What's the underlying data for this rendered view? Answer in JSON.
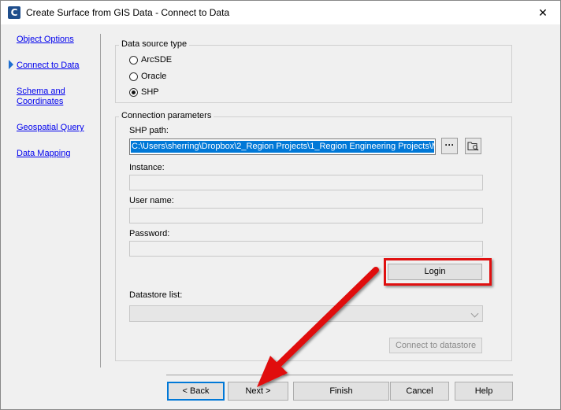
{
  "window": {
    "title": "Create Surface from GIS Data - Connect to Data",
    "close_glyph": "✕",
    "app_icon_letter": "C"
  },
  "nav": {
    "items": [
      {
        "label": "Object Options"
      },
      {
        "label": "Connect to Data"
      },
      {
        "label": "Schema and\nCoordinates"
      },
      {
        "label": "Geospatial Query"
      },
      {
        "label": "Data Mapping"
      }
    ],
    "active_index": 1
  },
  "data_source": {
    "title": "Data source type",
    "options": [
      {
        "label": "ArcSDE",
        "checked": false
      },
      {
        "label": "Oracle",
        "checked": false
      },
      {
        "label": "SHP",
        "checked": true
      }
    ]
  },
  "connection": {
    "title": "Connection parameters",
    "shp_path_label": "SHP path:",
    "shp_path_value": "C:\\Users\\sherring\\Dropbox\\2_Region Projects\\1_Region Engineering Projects\\M",
    "browse_glyph": "···",
    "instance_label": "Instance:",
    "username_label": "User name:",
    "password_label": "Password:",
    "login_label": "Login",
    "datastore_label": "Datastore list:",
    "connect_label": "Connect to datastore"
  },
  "footer": {
    "back_label": "< Back",
    "next_label": "Next >",
    "finish_label": "Finish",
    "cancel_label": "Cancel",
    "help_label": "Help"
  },
  "colors": {
    "accent": "#0078d7",
    "annotation_red": "#e01010",
    "link": "#0000ee"
  }
}
